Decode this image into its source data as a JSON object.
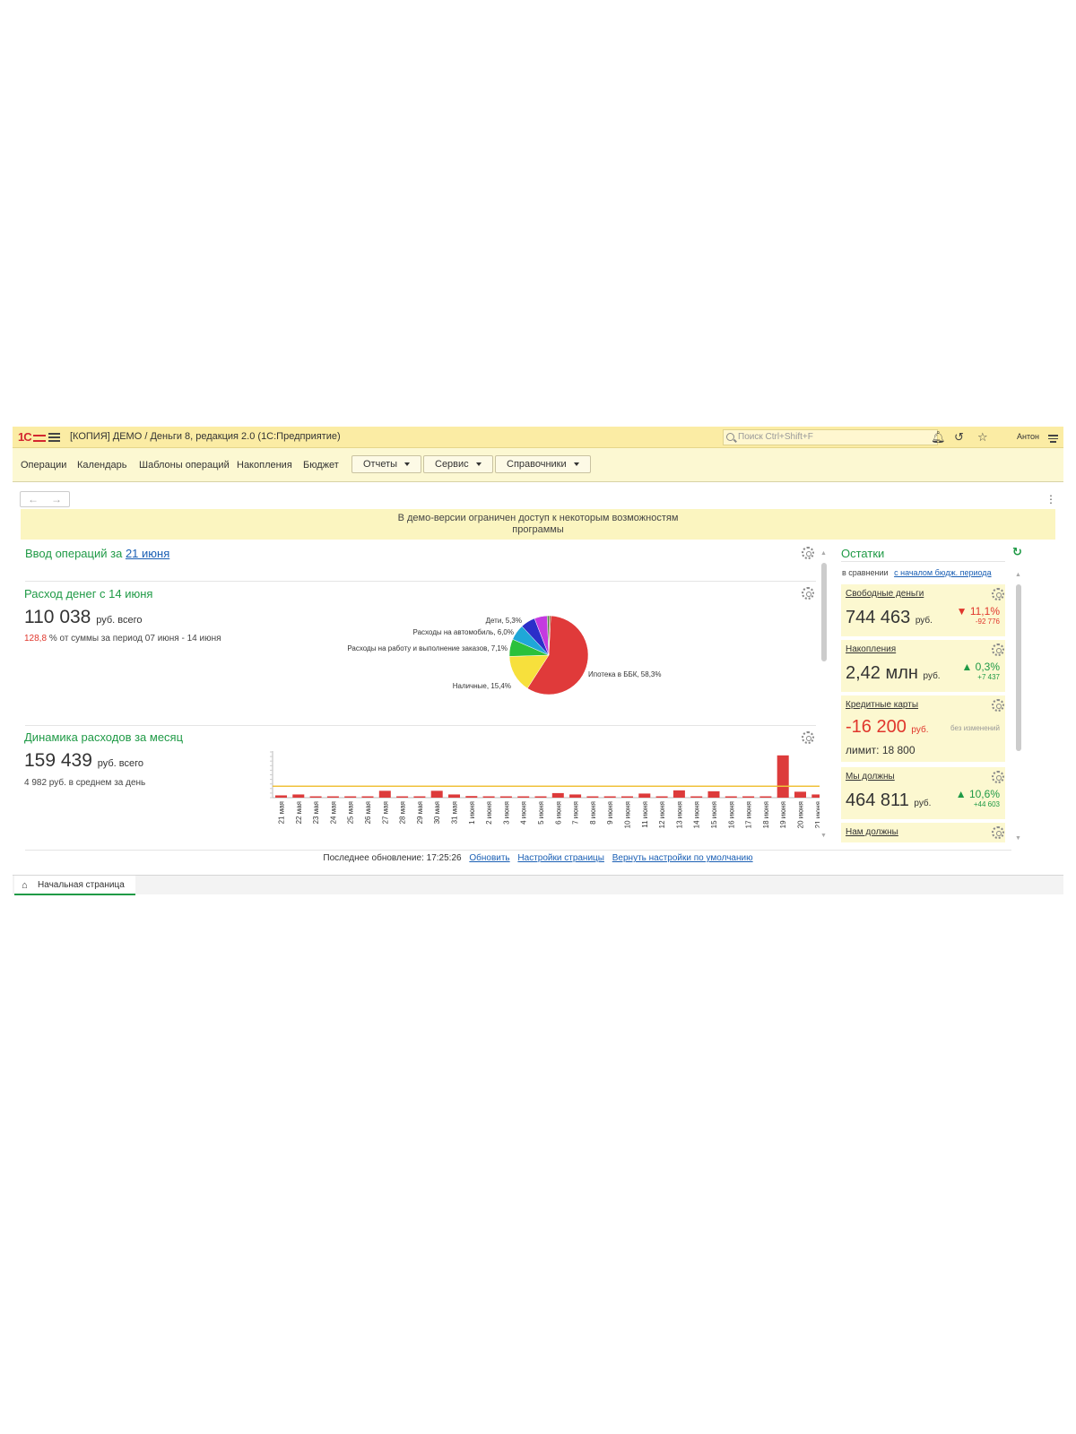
{
  "window": {
    "logo": "1С",
    "title": "[КОПИЯ] ДЕМО / Деньги 8, редакция 2.0  (1С:Предприятие)",
    "search_placeholder": "Поиск Ctrl+Shift+F",
    "user": "Антон"
  },
  "nav": {
    "links": [
      "Операции",
      "Календарь",
      "Шаблоны операций",
      "Накопления",
      "Бюджет"
    ],
    "dropdowns": [
      "Отчеты",
      "Сервис",
      "Справочники"
    ]
  },
  "banner": {
    "line1": "В демо-версии ограничен доступ к некоторым возможностям",
    "line2": "программы"
  },
  "ops_entry": {
    "title": "Ввод операций за",
    "date_link": "21 июня"
  },
  "expense_week": {
    "title": "Расход денег с 14 июня",
    "amount": "110 038",
    "unit": "руб. всего",
    "percent": "128,8",
    "percent_text": "% от суммы за период 07 июня - 14 июня"
  },
  "expense_month": {
    "title": "Динамика расходов за месяц",
    "amount": "159 439",
    "unit": "руб. всего",
    "avg": "4 982 руб. в среднем за день"
  },
  "balances": {
    "title": "Остатки",
    "compare_label": "в сравнении",
    "compare_link": "с началом бюдж. периода",
    "cards": [
      {
        "title": "Свободные деньги",
        "value": "744 463",
        "unit": "руб.",
        "delta": "▼ 11,1%",
        "delta_abs": "-92 776",
        "trend": "down"
      },
      {
        "title": "Накопления",
        "value": "2,42 млн",
        "unit": "руб.",
        "delta": "▲ 0,3%",
        "delta_abs": "+7 437",
        "trend": "up"
      },
      {
        "title": "Кредитные карты",
        "value": "-16 200",
        "unit": "руб.",
        "delta": "без изменений",
        "limit": "лимит: 18 800",
        "trend": "none"
      },
      {
        "title": "Мы должны",
        "value": "464 811",
        "unit": "руб.",
        "delta": "▲ 10,6%",
        "delta_abs": "+44 603",
        "trend": "up"
      },
      {
        "title": "Нам должны"
      }
    ]
  },
  "footer": {
    "updated_label": "Последнее обновление: 17:25:26",
    "refresh": "Обновить",
    "settings": "Настройки страницы",
    "reset": "Вернуть настройки по умолчанию"
  },
  "tab": {
    "label": "Начальная страница"
  },
  "colors": {
    "titlebar": "#fbeca4",
    "accent_green": "#1f9a46",
    "accent_red": "#e0362c",
    "link_blue": "#1a5fb4"
  },
  "chart_data": [
    {
      "type": "pie",
      "slices": [
        {
          "label": "Ипотека в ББК, 58,3%",
          "value": 58.3,
          "color": "#e03a3a"
        },
        {
          "label": "Наличные, 15,4%",
          "value": 15.4,
          "color": "#f7e03c"
        },
        {
          "label": "",
          "value": 7.1,
          "color": "#2bc13b"
        },
        {
          "label": "Расходы на работу и выполнение заказов, 7,1%",
          "value": 6.5,
          "color": "#1fa7d8"
        },
        {
          "label": "Расходы на автомобиль, 6,0%",
          "value": 6.0,
          "color": "#2b2fc9"
        },
        {
          "label": "Дети, 5,3%",
          "value": 5.3,
          "color": "#c43ae0"
        },
        {
          "label": "",
          "value": 0.8,
          "color": "#4a8a3a"
        },
        {
          "label": "",
          "value": 0.6,
          "color": "#8a5a2a"
        }
      ]
    },
    {
      "type": "bar",
      "categories": [
        "21 мая",
        "22 мая",
        "23 мая",
        "24 мая",
        "25 мая",
        "26 мая",
        "27 мая",
        "28 мая",
        "29 мая",
        "30 мая",
        "31 мая",
        "1 июня",
        "2 июня",
        "3 июня",
        "4 июня",
        "5 июня",
        "6 июня",
        "7 июня",
        "8 июня",
        "9 июня",
        "10 июня",
        "11 июня",
        "12 июня",
        "13 июня",
        "14 июня",
        "15 июня",
        "16 июня",
        "17 июня",
        "18 июня",
        "19 июня",
        "20 июня",
        "21 июня"
      ],
      "values": [
        1000,
        1400,
        200,
        200,
        150,
        200,
        3000,
        200,
        200,
        3000,
        1400,
        700,
        200,
        150,
        200,
        200,
        2000,
        1400,
        150,
        150,
        150,
        1800,
        200,
        3200,
        200,
        2800,
        200,
        200,
        200,
        18500,
        2600,
        1400
      ],
      "average": 4982,
      "ylim": [
        0,
        20000
      ]
    }
  ]
}
